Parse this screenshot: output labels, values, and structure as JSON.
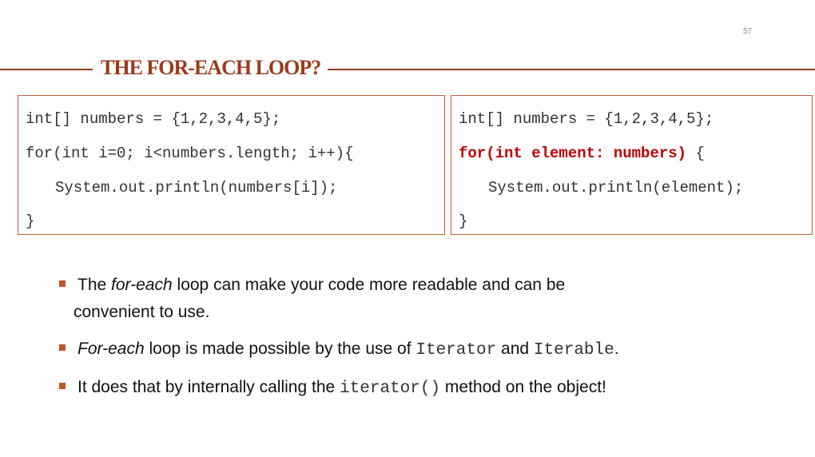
{
  "page_number": "57",
  "title": "THE FOR-EACH LOOP?",
  "left_code": {
    "line1": "int[] numbers = {1,2,3,4,5};",
    "line2": "for(int i=0; i<numbers.length; i++){",
    "line3": "System.out.println(numbers[i]);",
    "line4": "}"
  },
  "right_code": {
    "line1": "int[] numbers = {1,2,3,4,5};",
    "line2_keyword": "for(int element: numbers)",
    "line2_rest": " {",
    "line3": "System.out.println(element);",
    "line4": "}"
  },
  "bullets": [
    {
      "pre": "The ",
      "italic": "for-each",
      "post": " loop can make your code more readable and can be",
      "cont": "convenient to use."
    },
    {
      "italic": "For-each",
      "text1": " loop is made possible by the use of ",
      "mono1": "Iterator",
      "text2": " and ",
      "mono2": "Iterable",
      "text3": "."
    },
    {
      "text1": "It does that by internally calling the ",
      "mono1": "iterator()",
      "text2": " method on the object!"
    }
  ],
  "colors": {
    "accent": "#9c3a1a",
    "box_border": "#c0613c",
    "keyword": "#c00000",
    "bullet": "#c0562b"
  }
}
